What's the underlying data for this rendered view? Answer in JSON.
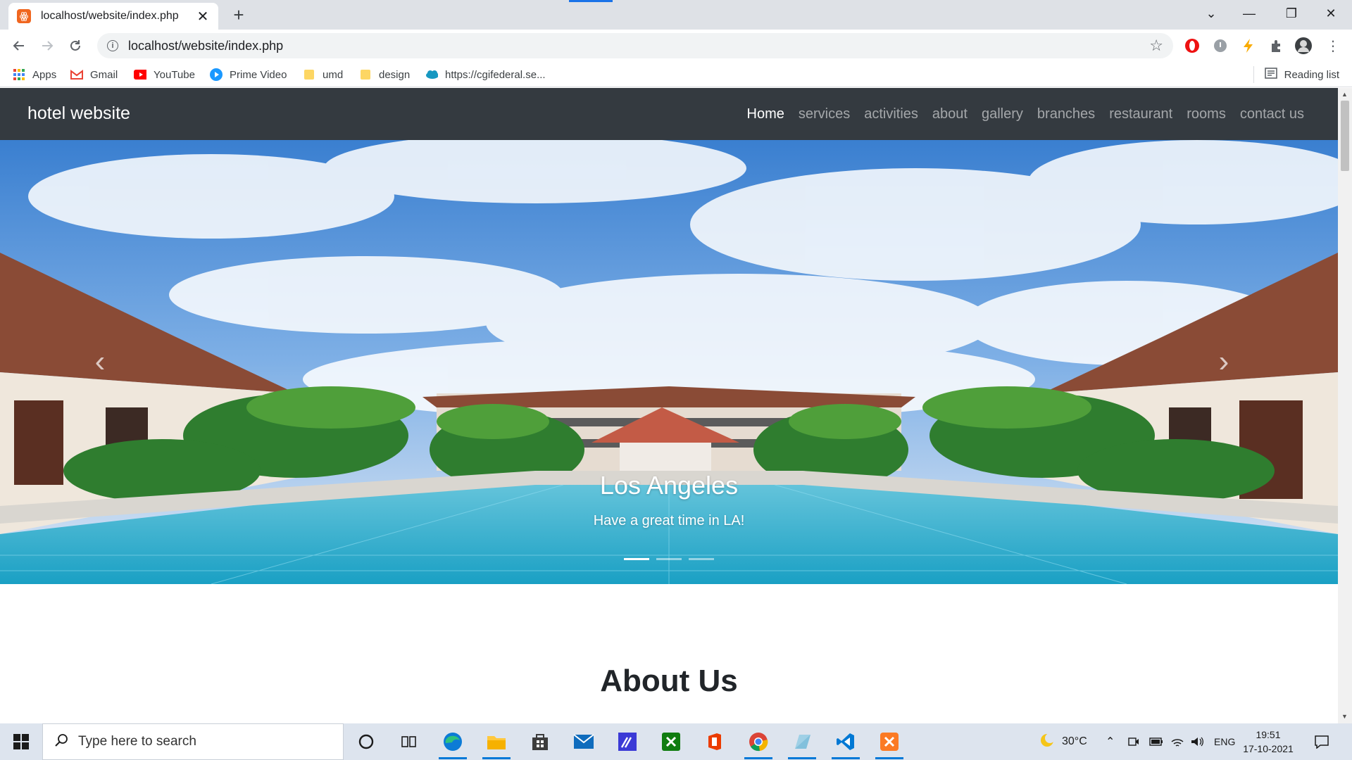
{
  "browser": {
    "tab_title": "localhost/website/index.php",
    "tab_close": "✕",
    "new_tab": "+",
    "url": "localhost/website/index.php",
    "window_controls": {
      "tab_search": "⌄",
      "minimize": "—",
      "restore": "❐",
      "close": "✕"
    },
    "bookmarks": [
      {
        "label": "Apps",
        "icon": "apps-grid-icon"
      },
      {
        "label": "Gmail",
        "icon": "gmail-icon"
      },
      {
        "label": "YouTube",
        "icon": "youtube-icon"
      },
      {
        "label": "Prime Video",
        "icon": "prime-video-icon"
      },
      {
        "label": "umd",
        "icon": "folder-icon"
      },
      {
        "label": "design",
        "icon": "folder-icon"
      },
      {
        "label": "https://cgifederal.se...",
        "icon": "salesforce-cloud-icon"
      }
    ],
    "reading_list": "Reading list"
  },
  "site": {
    "brand": "hotel website",
    "nav": [
      "Home",
      "services",
      "activities",
      "about",
      "gallery",
      "branches",
      "restaurant",
      "rooms",
      "contact us"
    ],
    "carousel": {
      "title": "Los Angeles",
      "subtitle": "Have a great time in LA!",
      "slide_count": 3,
      "active_slide": 1,
      "prev": "‹",
      "next": "›"
    },
    "about_heading": "About Us"
  },
  "taskbar": {
    "search_placeholder": "Type here to search",
    "weather": "30°C",
    "language": "ENG",
    "time": "19:51",
    "date": "17-10-2021"
  },
  "colors": {
    "navbar": "#343a40",
    "tab_strip": "#dee1e6",
    "taskbar": "#dde4ee",
    "accent": "#0078d7"
  }
}
